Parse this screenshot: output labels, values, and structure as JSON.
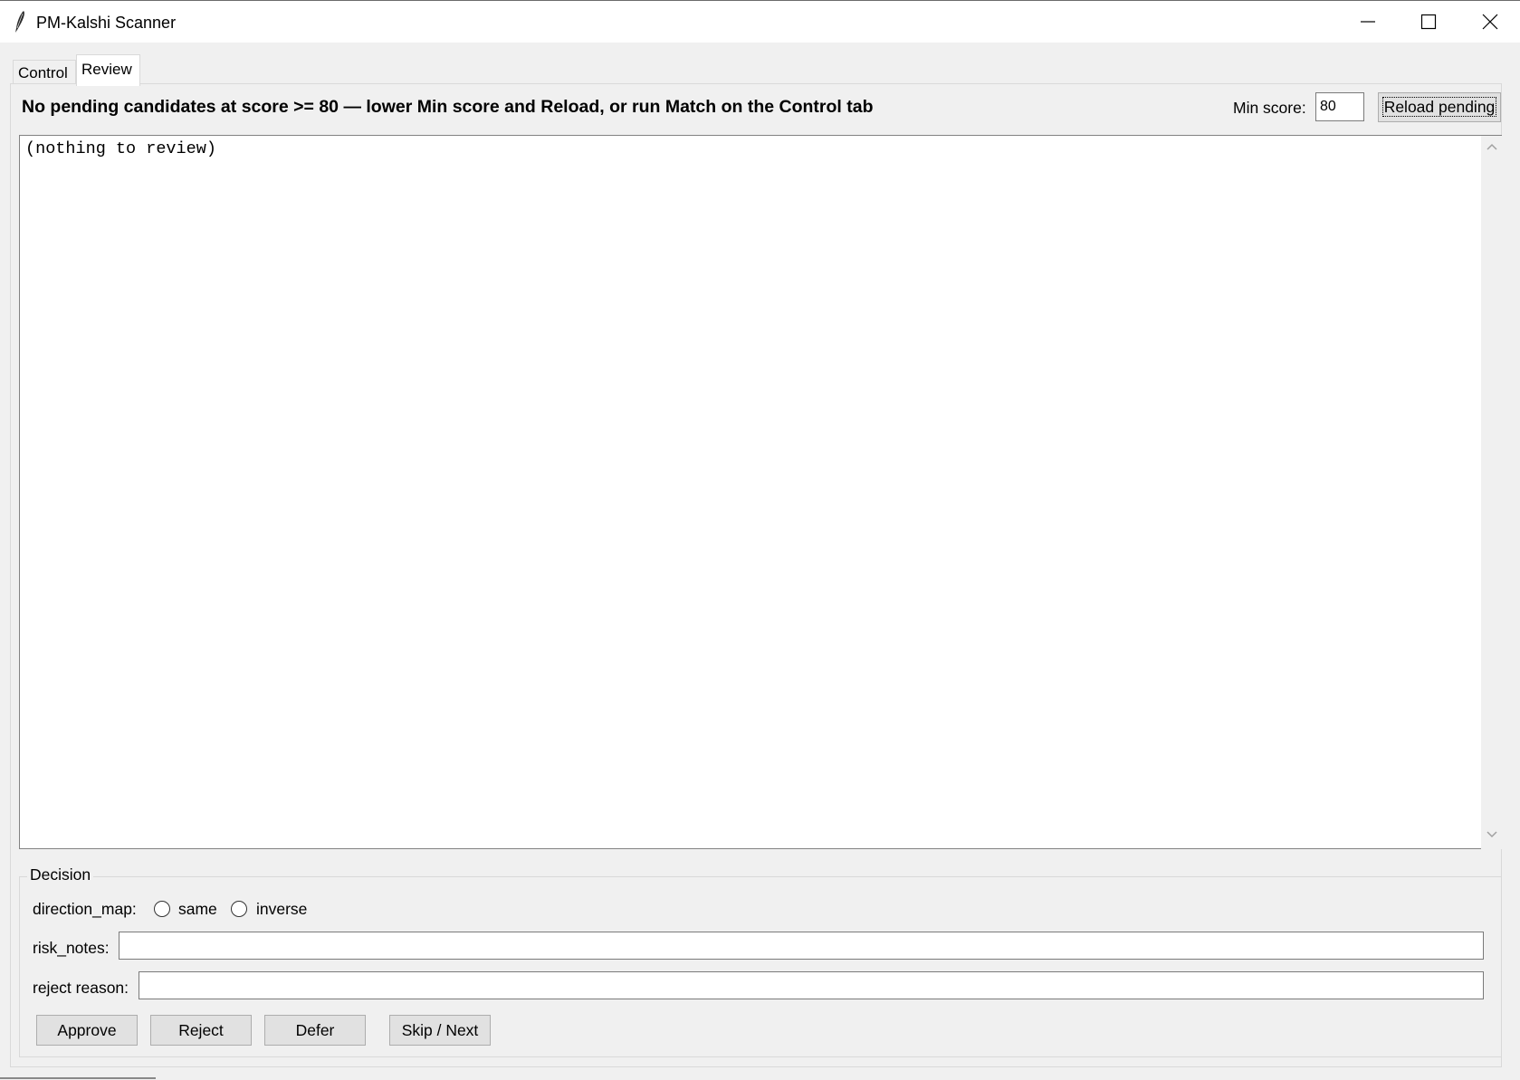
{
  "window": {
    "title": "PM-Kalshi Scanner",
    "icon": "feather-icon",
    "controls": [
      "minimize-icon",
      "maximize-icon",
      "close-icon"
    ]
  },
  "tabs": [
    {
      "label": "Control",
      "active": false
    },
    {
      "label": "Review",
      "active": true
    }
  ],
  "review": {
    "status_message": "No pending candidates at score >= 80 — lower Min score and Reload, or run Match on the Control tab",
    "min_score_label": "Min score:",
    "min_score_value": "80",
    "reload_label": "Reload pending",
    "text_content": "(nothing to review)"
  },
  "decision": {
    "legend": "Decision",
    "direction_map_label": "direction_map:",
    "direction_options": [
      {
        "label": "same",
        "selected": false
      },
      {
        "label": "inverse",
        "selected": false
      }
    ],
    "risk_notes_label": "risk_notes:",
    "risk_notes_value": "",
    "reject_reason_label": "reject reason:",
    "reject_reason_value": "",
    "buttons": {
      "approve": "Approve",
      "reject": "Reject",
      "defer": "Defer",
      "skip_next": "Skip / Next"
    }
  }
}
